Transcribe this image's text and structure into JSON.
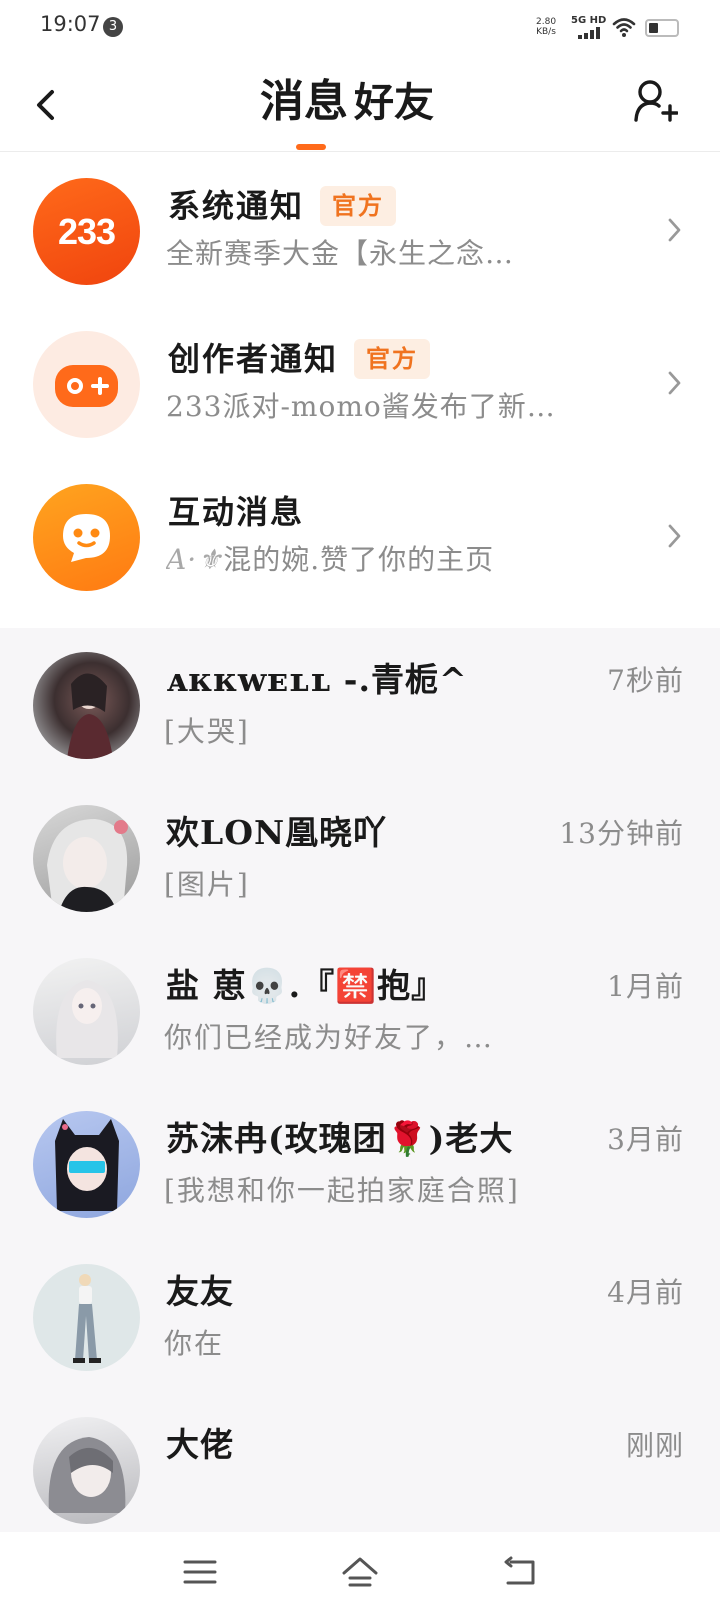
{
  "status_bar": {
    "time": "19:07",
    "notification_count": "3",
    "net_speed_value": "2.80",
    "net_speed_unit": "KB/s",
    "network": "5G HD"
  },
  "header": {
    "tabs": [
      {
        "label": "消息",
        "active": true
      },
      {
        "label": "好友",
        "active": false
      }
    ],
    "accent_color": "#ff6a1a"
  },
  "notices": [
    {
      "title": "系统通知",
      "tag": "官方",
      "subtitle": "全新赛季大金【永生之念…",
      "icon": "233-logo-icon"
    },
    {
      "title": "创作者通知",
      "tag": "官方",
      "subtitle": "233派对-momo酱发布了新…",
      "icon": "gamepad-icon"
    },
    {
      "title": "互动消息",
      "tag": "",
      "subtitle": "混的婉.赞了你的主页",
      "subtitle_prefix": "A·⚜",
      "icon": "chat-bubble-face-icon"
    }
  ],
  "chats": [
    {
      "name": "ᴀᴋᴋᴡᴇʟʟ -.青栀^",
      "time": "7秒前",
      "preview": "[大哭]"
    },
    {
      "name": "欢LON凰晓吖",
      "time": "13分钟前",
      "preview": "[图片]"
    },
    {
      "name": "盐 葸💀.『🈲抱』",
      "time": "1月前",
      "preview": "你们已经成为好友了，…"
    },
    {
      "name": "苏沫冉(玫瑰团🌹)老大",
      "time": "3月前",
      "preview": "[我想和你一起拍家庭合照]"
    },
    {
      "name": "友友",
      "time": "4月前",
      "preview": "你在"
    },
    {
      "name": "大佬",
      "time": "刚刚",
      "preview": ""
    }
  ],
  "nav": {
    "menu": "menu-icon",
    "home": "home-icon",
    "back": "back-icon"
  }
}
